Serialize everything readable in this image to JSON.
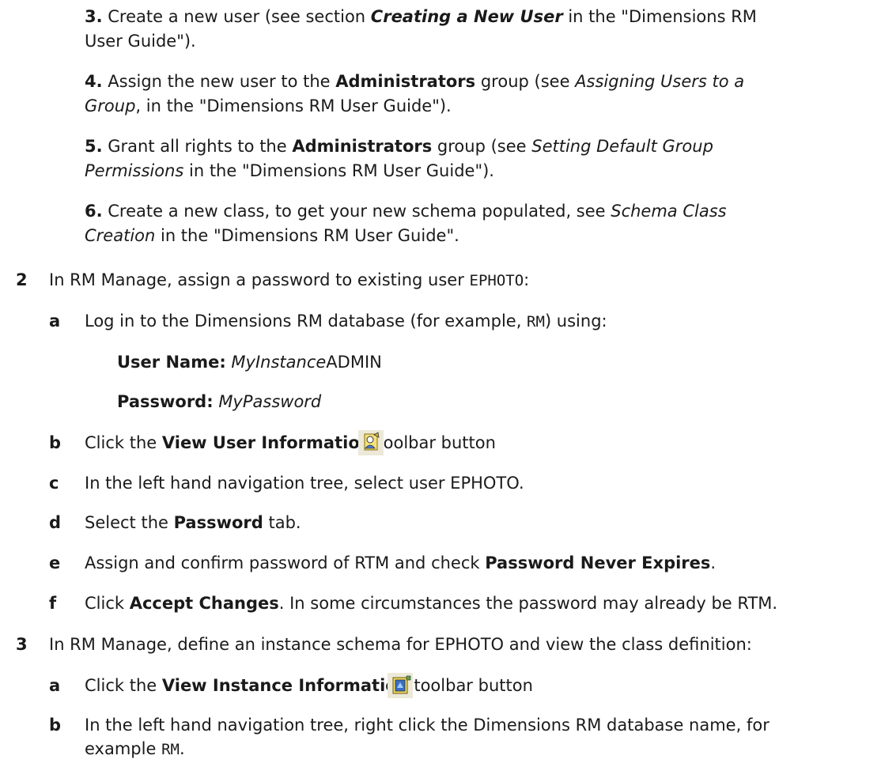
{
  "substeps": {
    "s3": {
      "num": "3.",
      "t1": " Create a new user (see section ",
      "em": "Creating a New User",
      "t2": " in the \"Dimensions RM",
      "line2": "User Guide\")."
    },
    "s4": {
      "num": "4.",
      "t1": " Assign the new user to the ",
      "b": "Administrators",
      "t2": " group (see ",
      "i1": "Assigning Users to a",
      "i2": "Group",
      "t3": ", in the \"Dimensions RM User Guide\")."
    },
    "s5": {
      "num": "5.",
      "t1": " Grant all rights to the ",
      "b": "Administrators",
      "t2": " group (see ",
      "i1": "Setting Default Group",
      "i2": "Permissions",
      "t3": " in the \"Dimensions RM User Guide\")."
    },
    "s6": {
      "num": "6.",
      "t1": " Create a new class, to get your new schema populated, see ",
      "i1": "Schema Class",
      "i2": "Creation",
      "t2": " in the \"Dimensions RM User Guide\"."
    }
  },
  "step2": {
    "num": "2",
    "t1": "In RM Manage, assign a password to existing user ",
    "code": "EPHOTO",
    "t2": ":",
    "a": {
      "letter": "a",
      "t1": "Log in to the Dimensions RM database (for example, ",
      "code": "RM",
      "t2": ") using:"
    },
    "user_label": "User Name:",
    "user_value_i": "MyInstance",
    "user_value": "ADMIN",
    "pass_label": "Password:",
    "pass_value_i": "MyPassword",
    "b": {
      "letter": "b",
      "t1": "Click the ",
      "bold": "View User Information",
      "t2": " toolbar button",
      "icon": "view-user-information-icon"
    },
    "c": {
      "letter": "c",
      "text": "In the left hand navigation tree, select user EPHOTO."
    },
    "d": {
      "letter": "d",
      "t1": "Select the ",
      "bold": "Password",
      "t2": " tab."
    },
    "e": {
      "letter": "e",
      "t1": "Assign and confirm password of RTM and check ",
      "bold": "Password Never Expires",
      "t2": "."
    },
    "f": {
      "letter": "f",
      "t1": "Click ",
      "bold": "Accept Changes",
      "t2": ". In some circumstances the password may already be RTM."
    }
  },
  "step3": {
    "num": "3",
    "text": "In RM Manage, define an instance schema for EPHOTO and view the class definition:",
    "a": {
      "letter": "a",
      "t1": "Click the ",
      "bold": "View Instance Information",
      "t2": " toolbar button",
      "icon": "view-instance-information-icon"
    },
    "b": {
      "letter": "b",
      "line1": "In the left hand navigation tree, right click the Dimensions RM database name, for",
      "line2_t": "example ",
      "line2_code": "RM",
      "line2_end": "."
    }
  }
}
